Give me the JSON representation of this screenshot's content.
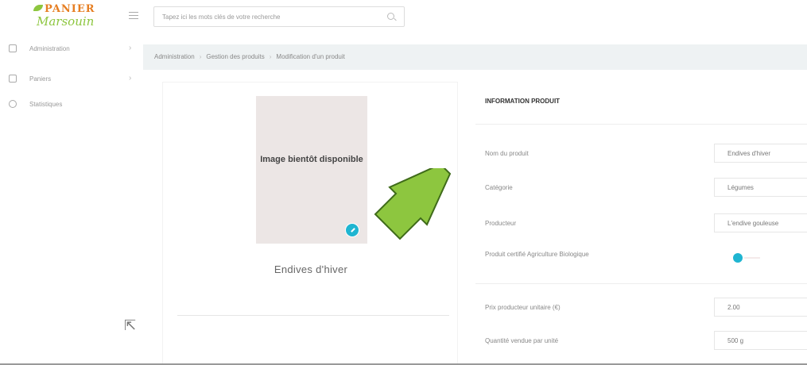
{
  "logo": {
    "line1": "PANIER",
    "line2": "Marsouin"
  },
  "search": {
    "placeholder": "Tapez ici les mots clés de votre recherche"
  },
  "sidebar": {
    "items": [
      {
        "label": "Administration",
        "icon": "admin-icon"
      },
      {
        "label": "Paniers",
        "icon": "calendar-icon"
      },
      {
        "label": "Statistiques",
        "icon": "clock-icon"
      }
    ]
  },
  "breadcrumb": [
    "Administration",
    "Gestion des produits",
    "Modification d'un produit"
  ],
  "product": {
    "image_placeholder": "Image bientôt disponible",
    "name": "Endives d'hiver"
  },
  "info": {
    "title": "INFORMATION PRODUIT",
    "fields": [
      {
        "label": "Nom du produit",
        "value": "Endives d'hiver"
      },
      {
        "label": "Catégorie",
        "value": "Légumes"
      },
      {
        "label": "Producteur",
        "value": "L'endive gouleuse"
      },
      {
        "label": "Produit certifié Agriculture Biologique",
        "value": ""
      },
      {
        "label": "Prix producteur unitaire (€)",
        "value": "2.00"
      },
      {
        "label": "Quantité vendue par unité",
        "value": "500 g"
      }
    ],
    "organic_certified": true
  },
  "colors": {
    "accent": "#1fb5d1",
    "arrow": "#8dc63f",
    "logo_orange": "#e67e22"
  }
}
